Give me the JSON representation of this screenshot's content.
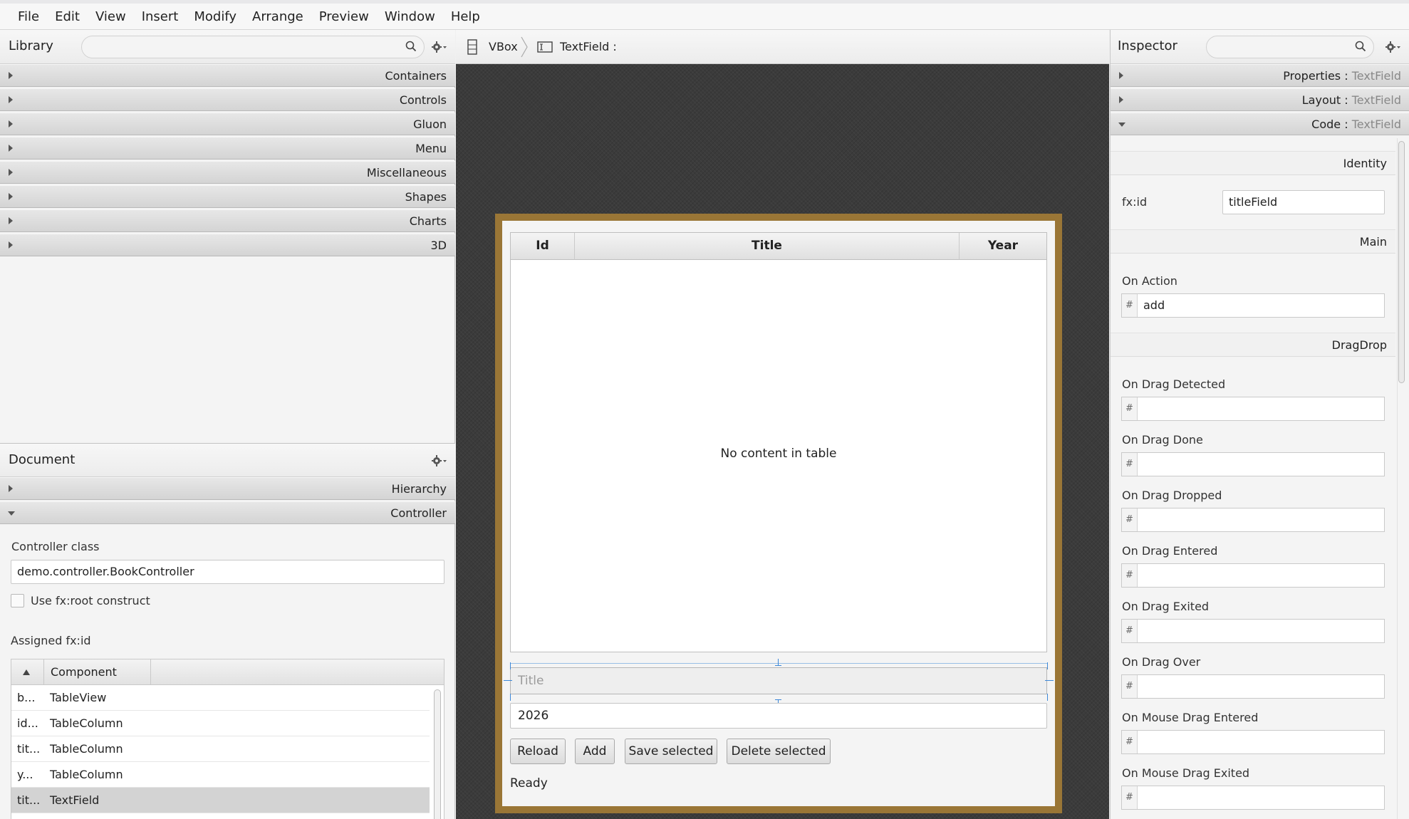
{
  "menu": [
    "File",
    "Edit",
    "View",
    "Insert",
    "Modify",
    "Arrange",
    "Preview",
    "Window",
    "Help"
  ],
  "library": {
    "title": "Library",
    "search_placeholder": "",
    "sections": [
      "Containers",
      "Controls",
      "Gluon",
      "Menu",
      "Miscellaneous",
      "Shapes",
      "Charts",
      "3D"
    ]
  },
  "document": {
    "title": "Document",
    "sections": [
      "Hierarchy",
      "Controller"
    ],
    "controller_class_label": "Controller class",
    "controller_class_value": "demo.controller.BookController",
    "use_fxroot_label": "Use fx:root construct",
    "use_fxroot_checked": false,
    "assigned_label": "Assigned fx:id",
    "table_headers": [
      "",
      "Component"
    ],
    "rows": [
      {
        "id": "b...",
        "component": "TableView"
      },
      {
        "id": "id...",
        "component": "TableColumn"
      },
      {
        "id": "tit...",
        "component": "TableColumn"
      },
      {
        "id": "y...",
        "component": "TableColumn"
      },
      {
        "id": "tit...",
        "component": "TextField"
      }
    ],
    "selected_row": 4
  },
  "breadcrumb": [
    "VBox",
    "TextField :"
  ],
  "canvas": {
    "columns": [
      "Id",
      "Title",
      "Year"
    ],
    "empty_text": "No content in table",
    "title_placeholder": "Title",
    "year_value": "2026",
    "buttons": [
      "Reload",
      "Add",
      "Save selected",
      "Delete selected"
    ],
    "status": "Ready"
  },
  "inspector": {
    "title": "Inspector",
    "sections": [
      {
        "label": "Properties",
        "sub": "TextField"
      },
      {
        "label": "Layout",
        "sub": "TextField"
      },
      {
        "label": "Code",
        "sub": "TextField"
      }
    ],
    "separator": " : ",
    "identity_header": "Identity",
    "fxid_label": "fx:id",
    "fxid_value": "titleField",
    "main_header": "Main",
    "on_action_label": "On Action",
    "on_action_value": "add",
    "dragdrop_header": "DragDrop",
    "hash": "#",
    "events": [
      "On Drag Detected",
      "On Drag Done",
      "On Drag Dropped",
      "On Drag Entered",
      "On Drag Exited",
      "On Drag Over",
      "On Mouse Drag Entered",
      "On Mouse Drag Exited"
    ]
  },
  "colors": {
    "accent": "#3c87d8",
    "frame": "#9a7636",
    "canvas_bg": "#3b3b3b"
  }
}
